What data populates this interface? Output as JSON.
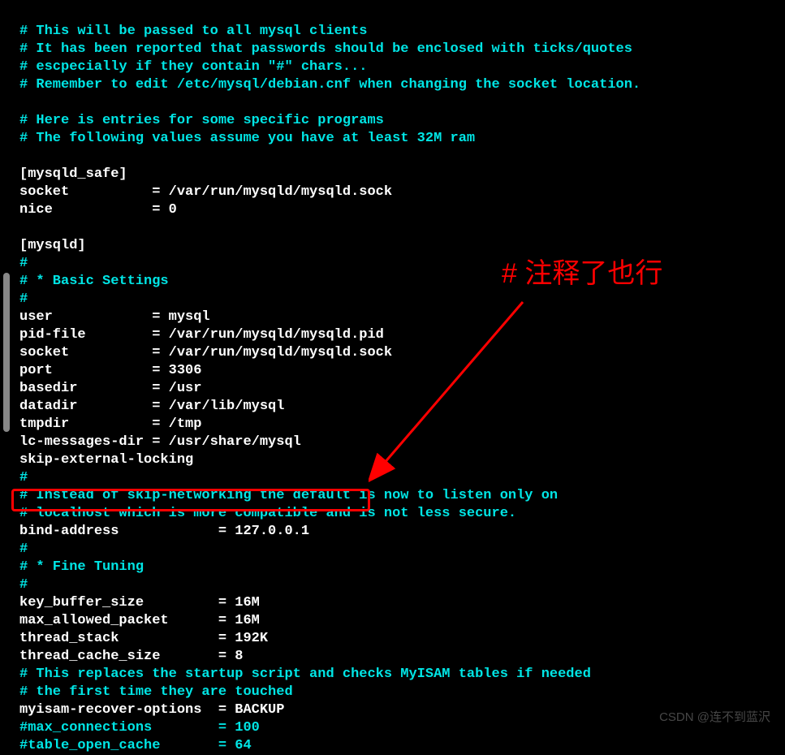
{
  "annotation": "# 注释了也行",
  "watermark": "CSDN @连不到蓝沢",
  "lines": [
    {
      "cls": "comment",
      "text": "# This will be passed to all mysql clients"
    },
    {
      "cls": "comment",
      "text": "# It has been reported that passwords should be enclosed with ticks/quotes"
    },
    {
      "cls": "comment",
      "text": "# escpecially if they contain \"#\" chars..."
    },
    {
      "cls": "comment",
      "text": "# Remember to edit /etc/mysql/debian.cnf when changing the socket location."
    },
    {
      "cls": "comment",
      "text": ""
    },
    {
      "cls": "comment",
      "text": "# Here is entries for some specific programs"
    },
    {
      "cls": "comment",
      "text": "# The following values assume you have at least 32M ram"
    },
    {
      "cls": "comment",
      "text": ""
    },
    {
      "cls": "white",
      "text": "[mysqld_safe]"
    },
    {
      "cls": "white",
      "text": "socket          = /var/run/mysqld/mysqld.sock"
    },
    {
      "cls": "white",
      "text": "nice            = 0"
    },
    {
      "cls": "white",
      "text": ""
    },
    {
      "cls": "white",
      "text": "[mysqld]"
    },
    {
      "cls": "comment",
      "text": "#"
    },
    {
      "cls": "comment",
      "text": "# * Basic Settings"
    },
    {
      "cls": "comment",
      "text": "#"
    },
    {
      "cls": "white",
      "text": "user            = mysql"
    },
    {
      "cls": "white",
      "text": "pid-file        = /var/run/mysqld/mysqld.pid"
    },
    {
      "cls": "white",
      "text": "socket          = /var/run/mysqld/mysqld.sock"
    },
    {
      "cls": "white",
      "text": "port            = 3306"
    },
    {
      "cls": "white",
      "text": "basedir         = /usr"
    },
    {
      "cls": "white",
      "text": "datadir         = /var/lib/mysql"
    },
    {
      "cls": "white",
      "text": "tmpdir          = /tmp"
    },
    {
      "cls": "white",
      "text": "lc-messages-dir = /usr/share/mysql"
    },
    {
      "cls": "white",
      "text": "skip-external-locking"
    },
    {
      "cls": "comment",
      "text": "#"
    },
    {
      "cls": "comment",
      "text": "# Instead of skip-networking the default is now to listen only on"
    },
    {
      "cls": "comment",
      "text": "# localhost which is more compatible and is not less secure."
    },
    {
      "cls": "white",
      "text": "bind-address            = 127.0.0.1"
    },
    {
      "cls": "comment",
      "text": "#"
    },
    {
      "cls": "comment",
      "text": "# * Fine Tuning"
    },
    {
      "cls": "comment",
      "text": "#"
    },
    {
      "cls": "white",
      "text": "key_buffer_size         = 16M"
    },
    {
      "cls": "white",
      "text": "max_allowed_packet      = 16M"
    },
    {
      "cls": "white",
      "text": "thread_stack            = 192K"
    },
    {
      "cls": "white",
      "text": "thread_cache_size       = 8"
    },
    {
      "cls": "comment",
      "text": "# This replaces the startup script and checks MyISAM tables if needed"
    },
    {
      "cls": "comment",
      "text": "# the first time they are touched"
    },
    {
      "cls": "white",
      "text": "myisam-recover-options  = BACKUP"
    },
    {
      "cls": "comment",
      "text": "#max_connections        = 100"
    },
    {
      "cls": "comment",
      "text": "#table_open_cache       = 64"
    }
  ]
}
